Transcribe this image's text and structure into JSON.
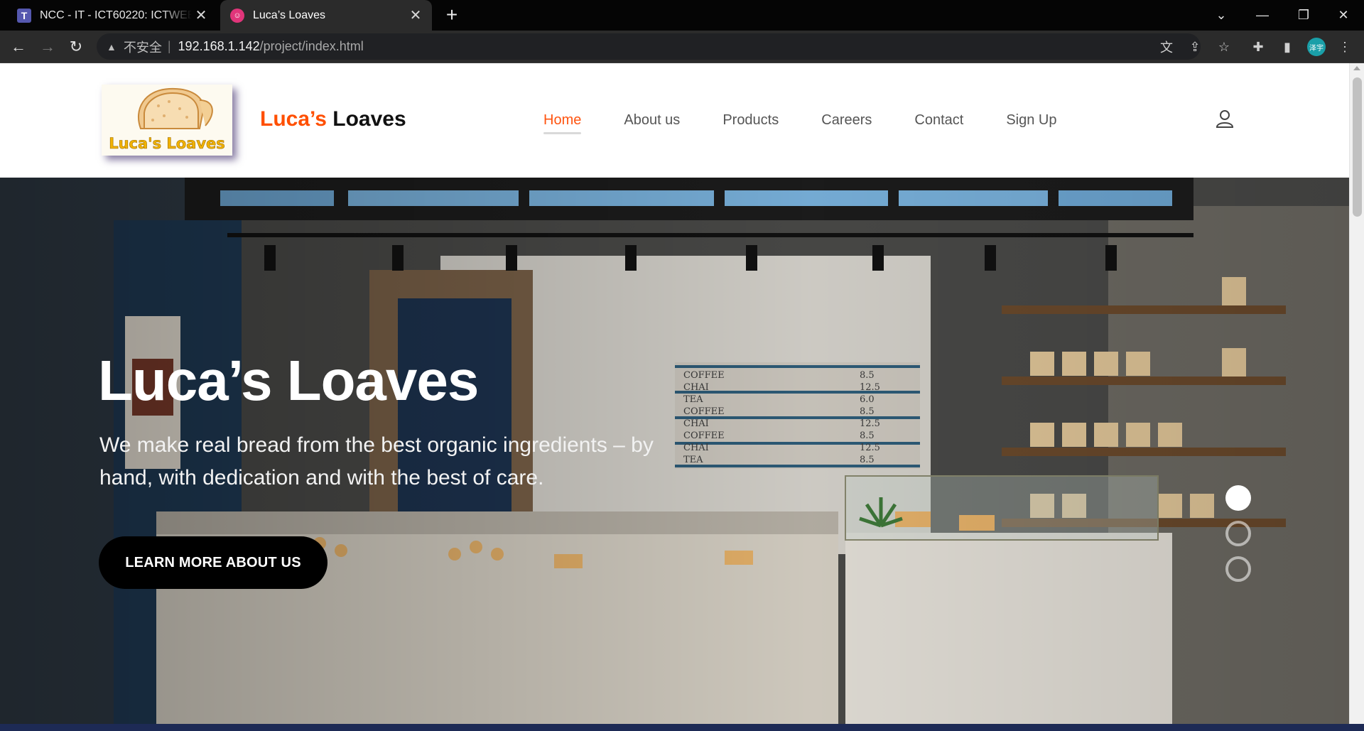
{
  "browser": {
    "tabs": [
      {
        "title": "NCC - IT - ICT60220: ICTWEB5",
        "favicon": "T",
        "active": false
      },
      {
        "title": "Luca’s Loaves",
        "favicon": "☺",
        "active": true
      }
    ],
    "url": {
      "security_label": "不安全",
      "host": "192.168.1.142",
      "path": "/project/index.html"
    },
    "profile_initials": "泽宇"
  },
  "site": {
    "brand_accent": "Luca’s",
    "brand_rest": "Loaves",
    "logo_text": "Luca's Loaves",
    "nav": [
      {
        "label": "Home",
        "active": true
      },
      {
        "label": "About us",
        "active": false
      },
      {
        "label": "Products",
        "active": false
      },
      {
        "label": "Careers",
        "active": false
      },
      {
        "label": "Contact",
        "active": false
      },
      {
        "label": "Sign Up",
        "active": false
      }
    ],
    "colors": {
      "accent": "#ff4f00",
      "cta": "#000000"
    }
  },
  "hero": {
    "title": "Luca’s Loaves",
    "subtitle": "We make real bread from the best organic ingredients – by hand, with dedication and with the best of care.",
    "cta_label": "LEARN MORE ABOUT US",
    "menu_board": [
      {
        "item": "COFFEE",
        "price": "8.5"
      },
      {
        "item": "CHAI",
        "price": "12.5"
      },
      {
        "item": "TEA",
        "price": "6.0"
      },
      {
        "item": "COFFEE",
        "price": "8.5"
      },
      {
        "item": "CHAI",
        "price": "12.5"
      },
      {
        "item": "COFFEE",
        "price": "8.5"
      },
      {
        "item": "CHAI",
        "price": "12.5"
      },
      {
        "item": "TEA",
        "price": "8.5"
      }
    ],
    "slides": {
      "count": 3,
      "active_index": 0
    }
  }
}
